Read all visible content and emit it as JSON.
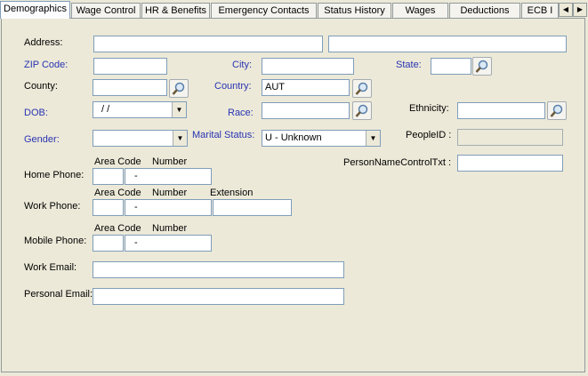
{
  "tabs": [
    {
      "label": "Demographics"
    },
    {
      "label": "Wage Control"
    },
    {
      "label": "HR & Benefits"
    },
    {
      "label": "Emergency Contacts"
    },
    {
      "label": "Status History"
    },
    {
      "label": "Wages"
    },
    {
      "label": "Deductions"
    },
    {
      "label": "ECB I"
    }
  ],
  "form": {
    "address_label": "Address:",
    "zip_label": "ZIP Code:",
    "city_label": "City:",
    "state_label": "State:",
    "county_label": "County:",
    "country_label": "Country:",
    "country_value": "AUT",
    "dob_label": "DOB:",
    "dob_value": " / /",
    "race_label": "Race:",
    "ethnicity_label": "Ethnicity:",
    "gender_label": "Gender:",
    "marital_label": "Marital Status:",
    "marital_value": "U - Unknown",
    "peopleid_label": "PeopleID :",
    "pnct_label": "PersonNameControlTxt :",
    "area_code_label": "Area Code",
    "number_label": "Number",
    "extension_label": "Extension",
    "home_phone_label": "Home Phone:",
    "work_phone_label": "Work Phone:",
    "mobile_phone_label": "Mobile Phone:",
    "phone_dash": "-",
    "work_email_label": "Work Email:",
    "personal_email_label": "Personal Email:"
  },
  "colors": {
    "required_label": "#2833b3"
  },
  "icons": {
    "lookup": "magnifier-icon",
    "dropdown": "chevron-down-icon",
    "scroll_left": "arrow-left-icon",
    "scroll_right": "arrow-right-icon"
  }
}
